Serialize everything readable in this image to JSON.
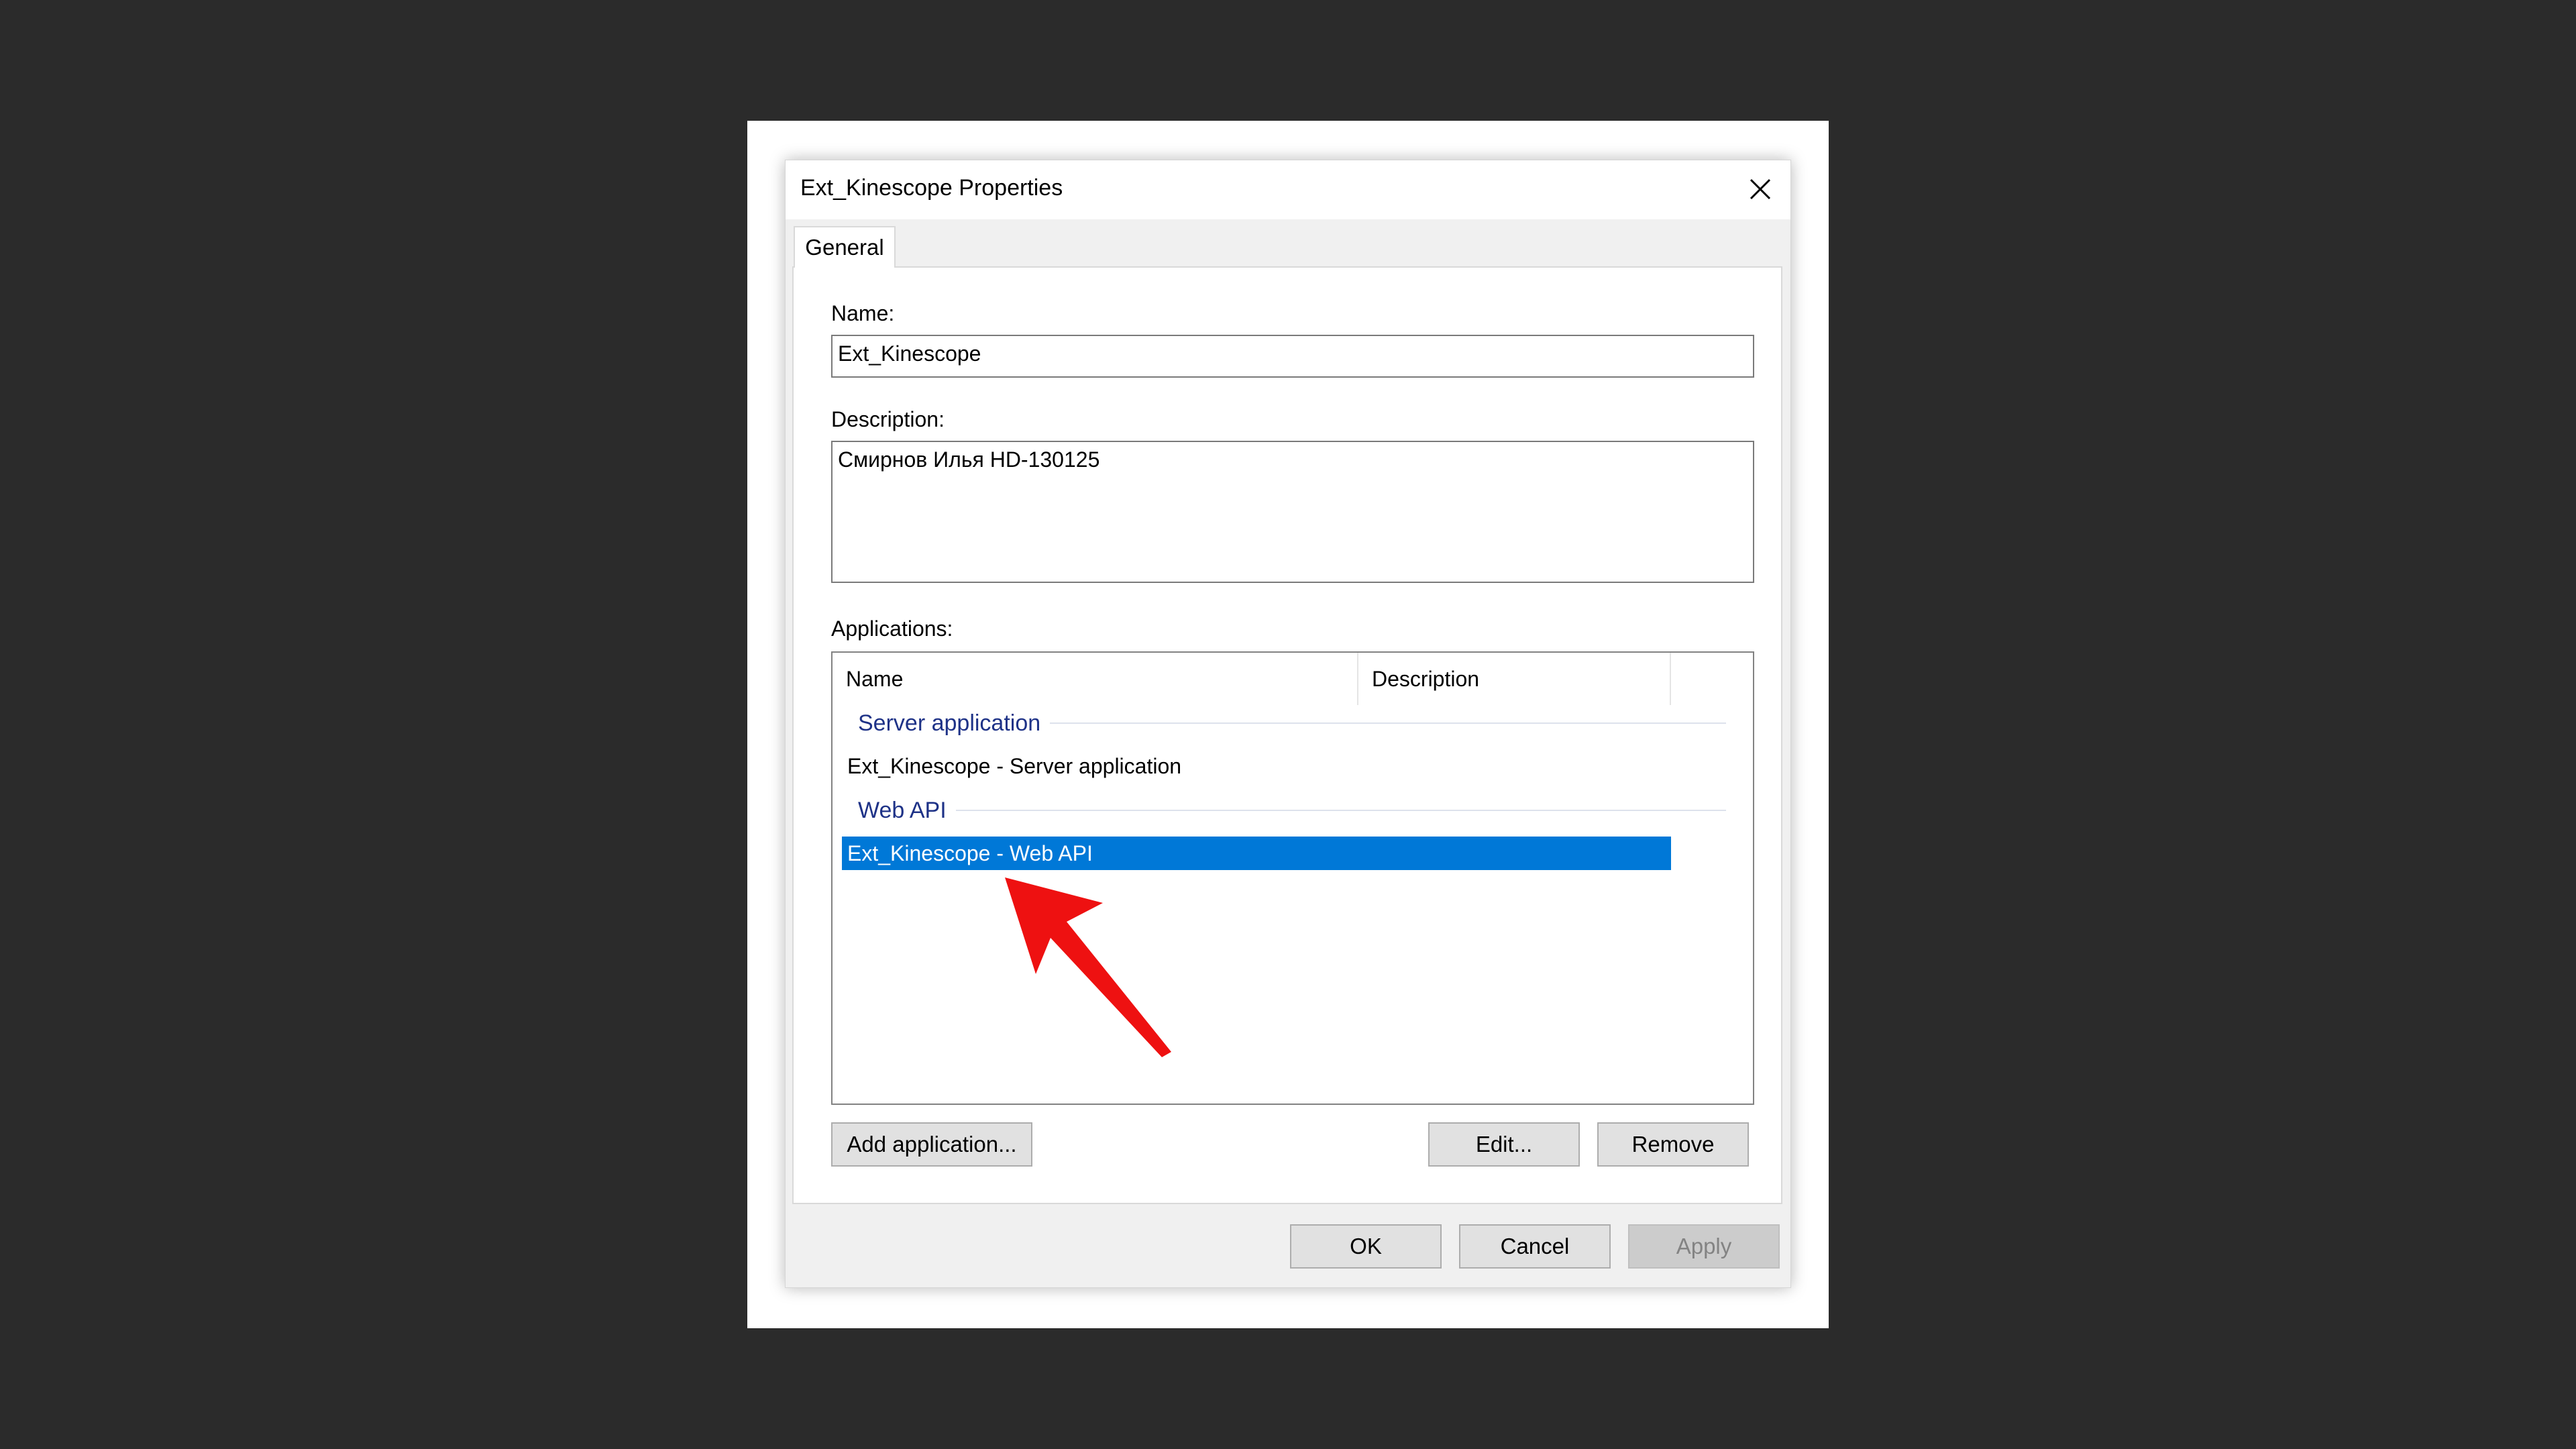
{
  "dialog": {
    "title": "Ext_Kinescope Properties",
    "close_icon": "close-icon"
  },
  "tabs": [
    {
      "label": "General",
      "selected": true
    }
  ],
  "form": {
    "name_label": "Name:",
    "name_value": "Ext_Kinescope",
    "description_label": "Description:",
    "description_value": "Смирнов Илья HD-130125",
    "applications_label": "Applications:"
  },
  "applications": {
    "columns": [
      "Name",
      "Description"
    ],
    "groups": [
      {
        "title": "Server application",
        "items": [
          {
            "name": "Ext_Kinescope - Server application",
            "description": "",
            "selected": false
          }
        ]
      },
      {
        "title": "Web API",
        "items": [
          {
            "name": "Ext_Kinescope - Web API",
            "description": "",
            "selected": true
          }
        ]
      }
    ]
  },
  "panel_buttons": {
    "add_application": "Add application...",
    "edit": "Edit...",
    "remove": "Remove"
  },
  "footer_buttons": {
    "ok": "OK",
    "cancel": "Cancel",
    "apply": "Apply",
    "apply_enabled": false
  },
  "colors": {
    "selection": "#0078d7",
    "group_title": "#1e3287",
    "annotation_arrow": "#ee1111",
    "backdrop": "#2b2b2b"
  }
}
